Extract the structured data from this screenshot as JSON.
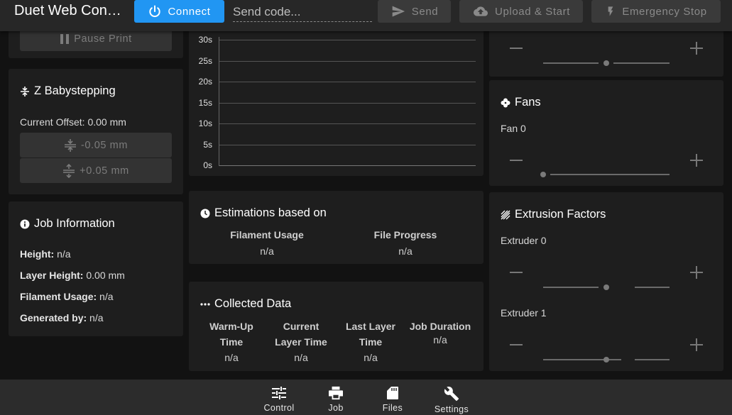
{
  "header": {
    "app_title": "Duet Web Con…",
    "connect_label": "Connect",
    "code_placeholder": "Send code...",
    "send_label": "Send",
    "upload_label": "Upload & Start",
    "estop_label": "Emergency Stop"
  },
  "left": {
    "pause_label": "Pause Print",
    "babystep": {
      "title": "Z Babystepping",
      "current_offset_label": "Current Offset:",
      "current_offset_value": "0.00 mm",
      "minus_label": "-0.05 mm",
      "plus_label": "+0.05 mm"
    },
    "job_info": {
      "title": "Job Information",
      "rows": [
        {
          "label": "Height:",
          "value": "n/a"
        },
        {
          "label": "Layer Height:",
          "value": "0.00 mm"
        },
        {
          "label": "Filament Usage:",
          "value": "n/a"
        },
        {
          "label": "Generated by:",
          "value": "n/a"
        }
      ]
    }
  },
  "chart_data": {
    "type": "line",
    "title": "",
    "xlabel": "",
    "ylabel": "",
    "y_tick_labels": [
      "30s",
      "25s",
      "20s",
      "15s",
      "10s",
      "5s",
      "0s"
    ],
    "ylim": [
      0,
      30
    ],
    "series": [],
    "grid": true
  },
  "estimations": {
    "title": "Estimations based on",
    "columns": [
      {
        "label": "Filament Usage",
        "value": "n/a"
      },
      {
        "label": "File Progress",
        "value": "n/a"
      }
    ]
  },
  "collected": {
    "title": "Collected Data",
    "columns": [
      {
        "label": "Warm-Up Time",
        "value": "n/a"
      },
      {
        "label": "Current Layer Time",
        "value": "n/a"
      },
      {
        "label": "Last Layer Time",
        "value": "n/a"
      },
      {
        "label": "Job Duration",
        "value": "n/a"
      }
    ]
  },
  "right": {
    "fans": {
      "title": "Fans",
      "items": [
        {
          "label": "Fan 0",
          "level": 0
        }
      ]
    },
    "extrusion": {
      "title": "Extrusion Factors",
      "items": [
        {
          "label": "Extruder 0",
          "level": 0.5
        },
        {
          "label": "Extruder 1",
          "level": 0.5
        }
      ]
    },
    "top_slider_level": 0.5
  },
  "bottom_nav": [
    {
      "label": "Control",
      "icon": "tune-icon"
    },
    {
      "label": "Job",
      "icon": "printer-icon"
    },
    {
      "label": "Files",
      "icon": "sd-card-icon"
    },
    {
      "label": "Settings",
      "icon": "wrench-icon"
    }
  ],
  "colors": {
    "accent": "#2196f3",
    "background": "#121212",
    "card": "#1e1e1e"
  }
}
